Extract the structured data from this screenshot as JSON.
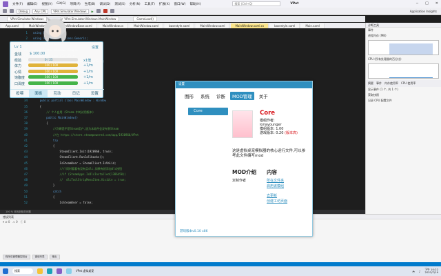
{
  "vs": {
    "search": "搜索 (Ctrl+Q)",
    "title": "VPet",
    "menu": [
      "文件(F)",
      "编辑(E)",
      "视图(V)",
      "Git(G)",
      "项目(P)",
      "生成(B)",
      "调试(D)",
      "测试(S)",
      "分析(N)",
      "工具(T)",
      "扩展(X)",
      "窗口(W)",
      "帮助(H)"
    ],
    "toolbar_config": "Debug",
    "toolbar_platform": "Any CPU",
    "toolbar_project": "VPet.Simulator.Windows",
    "toolbar_app_insights": "Application Insights",
    "tabs": [
      "App.xaml",
      "MainWindow.cs",
      "MainWindowBase.xaml",
      "MainWindow.cs",
      "MainWindow.xaml",
      "basestyle.xaml",
      "MainWindow.xaml",
      "MainWindow.xaml.cs",
      "basestyle.xaml",
      "Main.xaml"
    ],
    "active_tab_index": 7,
    "subtabs": [
      "VPet.Simulator.Windows",
      "VPet.Simulator.Windows.MainWindow",
      "GameLoad()"
    ],
    "bottom_panel_title": "错误列表",
    "bottom_panel_tabs": [
      "程序包管理器控制台",
      "错误列表",
      "输出"
    ],
    "side_title": "诊断工具",
    "side_events": "事件",
    "side_memory": "进程内存 (MB)",
    "side_cpu": "CPU (所有处理器的百分比)",
    "side_tab_summary": "摘要",
    "side_tab_events": "事件",
    "side_tab_memory": "内存使用率",
    "side_tab_cpu": "CPU 使用率",
    "side_item_event": "显示事件 (1 个, 共 1 个)",
    "side_item_memory": "获取快照",
    "side_item_cpu": "记录 CPU 配置文件"
  },
  "editor": {
    "lines": [
      {
        "n": "1",
        "text": "using System;",
        "cls": "kw"
      },
      {
        "n": "2",
        "text": "using System.Collections.Generic;",
        "cls": "kw"
      },
      {
        "n": "3",
        "text": "using System.Linq;",
        "cls": "kw"
      },
      {
        "n": "25",
        "text": "using System.Windows.Shapes;",
        "cls": "dim"
      },
      {
        "n": "26",
        "text": "using VPet_Simulator.Core;",
        "cls": "dim"
      },
      {
        "n": "27",
        "text": "using static VPet_Simulator.Core.GraphCore;",
        "cls": "dim"
      },
      {
        "n": "28",
        "text": "",
        "cls": "nm"
      },
      {
        "n": "29",
        "text": "namespace VPet.Simulator.Windows",
        "cls": "nm"
      },
      {
        "n": "30",
        "text": "{",
        "cls": "nm"
      },
      {
        "n": "31",
        "text": "    /// <summary>",
        "cls": "cm"
      },
      {
        "n": "32",
        "text": "    /// MainWindow.xaml 的交互逻辑",
        "cls": "cm"
      },
      {
        "n": "33",
        "text": "    /// </summary>",
        "cls": "cm"
      },
      {
        "n": "34",
        "text": "    public partial class MainWindow : Window",
        "cls": "kw"
      },
      {
        "n": "35",
        "text": "    {",
        "cls": "nm"
      },
      {
        "n": "36",
        "text": "        // 个人自用 (Steam 中的试用版本)",
        "cls": "cm"
      },
      {
        "n": "37",
        "text": "        public MainWindow()",
        "cls": "kw"
      },
      {
        "n": "38",
        "text": "        {",
        "cls": "nm"
      },
      {
        "n": "39",
        "text": "            //判断是不是Steam用户,因为本软件会发布到Steam",
        "cls": "cm"
      },
      {
        "n": "40",
        "text": "            //在 https://store.steampowered.com/app/1920960/VPet",
        "cls": "cm"
      },
      {
        "n": "41",
        "text": "            try",
        "cls": "kw"
      },
      {
        "n": "42",
        "text": "            {",
        "cls": "nm"
      },
      {
        "n": "43",
        "text": "                SteamClient.Init(1920960, true);",
        "cls": "nm"
      },
      {
        "n": "44",
        "text": "                SteamClient.RunCallbacks();",
        "cls": "nm"
      },
      {
        "n": "45",
        "text": "                IsSteamUser = SteamClient.IsValid;",
        "cls": "nm"
      },
      {
        "n": "46",
        "text": "                ////同时看看有没有买dlc,如果有就添加dlc按钮",
        "cls": "cm"
      },
      {
        "n": "47",
        "text": "                //if (SteamApps.IsDlcInstalled(1386450))",
        "cls": "cm"
      },
      {
        "n": "48",
        "text": "                //  dlcToolStripMenuItem.Visible = true;",
        "cls": "cm"
      },
      {
        "n": "49",
        "text": "            }",
        "cls": "nm"
      },
      {
        "n": "50",
        "text": "            catch",
        "cls": "kw"
      },
      {
        "n": "51",
        "text": "            {",
        "cls": "nm"
      },
      {
        "n": "52",
        "text": "                IsSteamUser = false;",
        "cls": "nm"
      }
    ],
    "status": "100 %   未找到相关问题"
  },
  "taskbar": {
    "search_label": "搜索",
    "app_label": "VPet 虚拟桌宠",
    "time": "下午 10:22",
    "date": "2023/7/19"
  },
  "pet": {
    "level": "Lv 1",
    "settings_link": "设置",
    "stats": [
      {
        "name": "金钱",
        "value": "$ 100.00",
        "kind": "money"
      },
      {
        "name": "经验",
        "text": "0 / 25",
        "fraction": 0.0,
        "rate": "x1倍",
        "color": "#b0c4de"
      },
      {
        "name": "体力",
        "text": "100 / 100",
        "fraction": 1.0,
        "rate": "+1/m",
        "color": "#e0b33a"
      },
      {
        "name": "心情",
        "text": "100 / 100",
        "fraction": 1.0,
        "rate": "+1/m",
        "color": "#e0b33a"
      },
      {
        "name": "饱腹度",
        "text": "100 / 100",
        "fraction": 1.0,
        "rate": "+1/m",
        "color": "#45b449"
      },
      {
        "name": "口渴度",
        "text": "100 / 100",
        "fraction": 1.0,
        "rate": "+1/m",
        "color": "#45b449"
      }
    ],
    "tabs": [
      "投喂",
      "面板",
      "互动",
      "日记",
      "设置"
    ],
    "active_tab": 1
  },
  "dialog": {
    "title": "设置",
    "tabs": [
      "图形",
      "系统",
      "诊断",
      "MOD管理",
      "关于"
    ],
    "active_tab": 3,
    "mod_list": [
      "Core"
    ],
    "mod_name": "Core",
    "mod_author_label": "模组作者:",
    "mod_author": "loriayounger",
    "mod_version": "模组版本: 1.00",
    "game_version": "游戏版本: 0.20",
    "game_version_warn": "(版本高)",
    "mod_desc": "这是虚拟桌宠模拟器的核心运行文件,可以参考此文件编写mod",
    "intro_title": "MOD介绍",
    "intro_sub": "定制作者",
    "content_title": "内容",
    "content_links": [
      "所在文件夹",
      "启用该模组",
      "去更新",
      "创建工坊页面"
    ],
    "footer": "游戏版本v0.10 x86"
  }
}
